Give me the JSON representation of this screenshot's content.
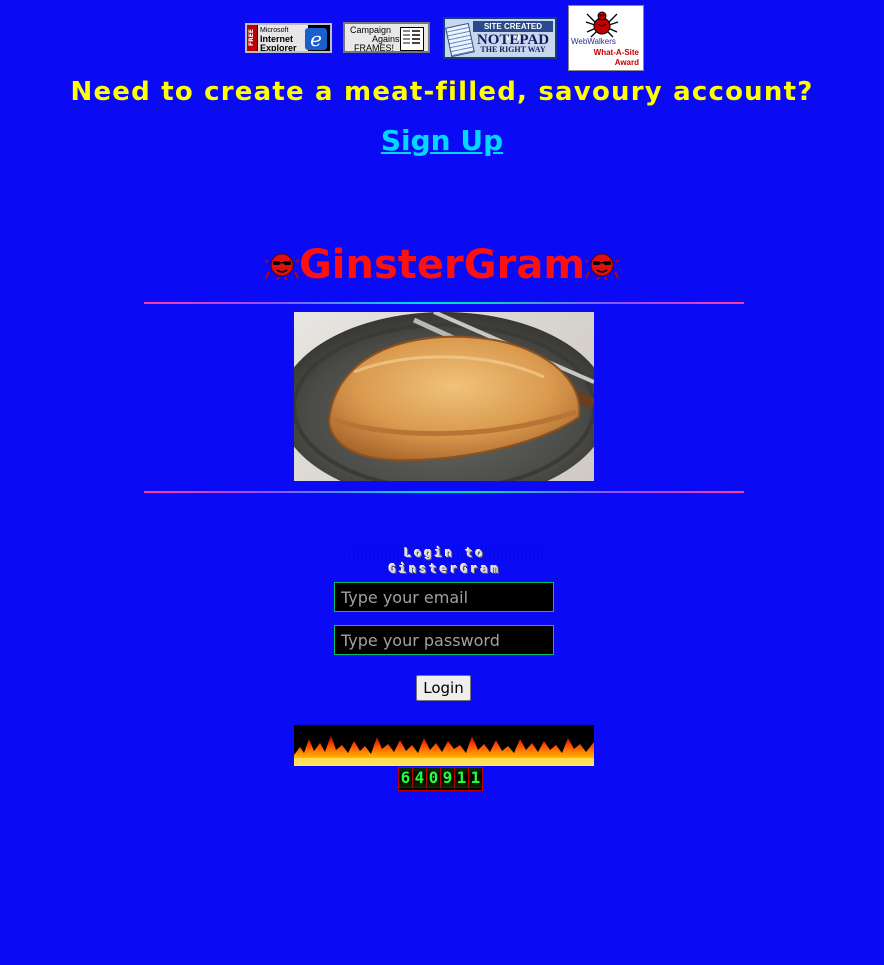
{
  "badges": {
    "ie": {
      "free": "FREE",
      "line1": "Microsoft",
      "line2": "Internet",
      "line3": "Explorer",
      "logo": "e"
    },
    "frames": {
      "line1": "Campaign",
      "line2": "Against",
      "line3": "FRAMES!"
    },
    "notepad": {
      "top": "SITE CREATED WITH",
      "mid": "NOTEPAD",
      "bottom": "THE RIGHT WAY"
    },
    "webwalkers": {
      "brand": "WebWalkers",
      "award_line1": "What-A-Site",
      "award_line2": "Award"
    }
  },
  "headline": "Need to create a meat-filled, savoury account?",
  "signup_label": "Sign Up",
  "brand_name": "GinsterGram",
  "login_heading": "Login to GinsterGram",
  "form": {
    "email_placeholder": "Type your email",
    "password_placeholder": "Type your password",
    "login_label": "Login"
  },
  "counter": {
    "digits": [
      "6",
      "4",
      "0",
      "9",
      "1",
      "1"
    ]
  },
  "colors": {
    "background": "#0a0af5",
    "headline": "#ffff00",
    "link": "#00d8ff",
    "brand": "#ff1010",
    "field_border": "#00c060",
    "counter_digit": "#20ff40"
  },
  "icons": {
    "mascot": "sunglasses-mascot-icon",
    "spider": "spider-icon",
    "notepad": "notepad-icon",
    "frames": "frames-window-icon"
  }
}
